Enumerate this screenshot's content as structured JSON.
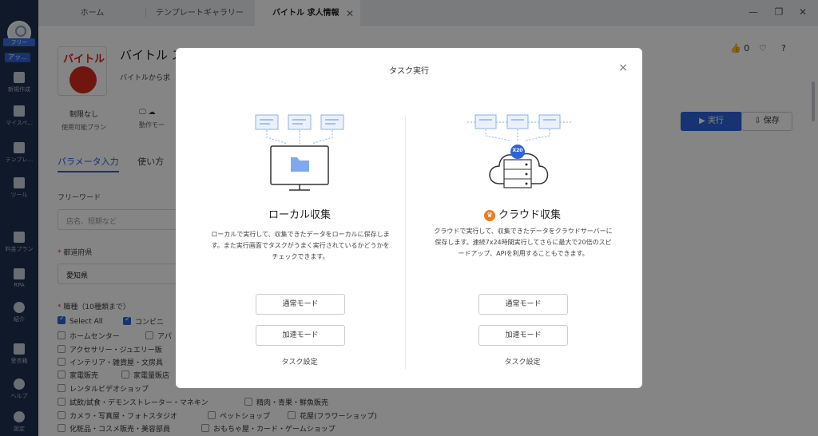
{
  "sidebar": {
    "badge_free": "フリー",
    "badge_upgrade": "アッ...",
    "items": [
      {
        "label": "新規作成",
        "icon": "plus-icon"
      },
      {
        "label": "マイスペ...",
        "icon": "bookmark-icon"
      },
      {
        "label": "テンプレ...",
        "icon": "template-icon"
      },
      {
        "label": "ツール",
        "icon": "toolbox-icon"
      },
      {
        "label": "料金プラン",
        "icon": "crown-icon"
      },
      {
        "label": "RPA",
        "icon": "rpa-icon"
      },
      {
        "label": "紹介",
        "icon": "dollar-icon"
      },
      {
        "label": "受信箱",
        "icon": "bell-icon"
      },
      {
        "label": "ヘルプ",
        "icon": "help-icon"
      },
      {
        "label": "設定",
        "icon": "gear-icon"
      }
    ]
  },
  "tabs": [
    {
      "label": "ホーム"
    },
    {
      "label": "テンプレートギャラリー"
    },
    {
      "label": "バイトル 求人情報",
      "close": "✕"
    }
  ],
  "window_controls": {
    "minimize": "—",
    "restore": "❐",
    "close": "✕"
  },
  "page": {
    "logo_text": "バイトル",
    "title": "バイトル ス",
    "subtitle": "バイトルから求",
    "meta": [
      {
        "value": "制限なし",
        "label": "使用可能プラン"
      },
      {
        "value": "🖵 ☁",
        "label": "動作モー"
      }
    ],
    "likes": "0",
    "run_label": "実行",
    "save_label": "保存",
    "param_tabs": [
      "パラメータ入力",
      "使い方"
    ],
    "freeword_label": "フリーワード",
    "freeword_placeholder": "店名、短期など",
    "pref_label": "都道府県",
    "pref_value": "愛知県",
    "job_label": "職種（10種類まで）",
    "checkboxes": [
      {
        "label": "Select All",
        "checked": true
      },
      {
        "label": "コンビニ",
        "checked": true
      },
      {
        "label": "ホームセンター",
        "checked": false
      },
      {
        "label": "アパ",
        "checked": false
      },
      {
        "label": "アクセサリー・ジュエリー販",
        "checked": false
      },
      {
        "label": "インテリア・雑貨屋・文房具",
        "checked": false
      },
      {
        "label": "家電販売",
        "checked": false
      },
      {
        "label": "家電量販店",
        "checked": false
      },
      {
        "label": "レンタルビデオショップ",
        "checked": false
      },
      {
        "label": "試飲/試食・デモンストレーター・マネキン",
        "checked": false
      },
      {
        "label": "精肉・青果・鮮魚販売",
        "checked": false
      },
      {
        "label": "カメラ・写真屋・フォトスタジオ",
        "checked": false
      },
      {
        "label": "ペットショップ",
        "checked": false
      },
      {
        "label": "花屋(フラワーショップ)",
        "checked": false
      },
      {
        "label": "化粧品・コスメ販売・美容部員",
        "checked": false
      },
      {
        "label": "おもちゃ屋・カード・ゲームショップ",
        "checked": false
      }
    ]
  },
  "modal": {
    "title": "タスク実行",
    "close": "×",
    "local": {
      "title": "ローカル収集",
      "desc": "ローカルで実行して、収集できたデータをローカルに保存します。また実行画面でタスクがうまく実行されているかどうかをチェックできます。",
      "normal_mode": "通常モード",
      "fast_mode": "加速モード",
      "task_settings": "タスク設定"
    },
    "cloud": {
      "title": "クラウド収集",
      "badge": "X20",
      "desc": "クラウドで実行して、収集できたデータをクラウドサーバーに保存します。連続7x24時間実行してさらに最大で20倍のスピードアップ、APIを利用することもできます。",
      "normal_mode": "通常モード",
      "fast_mode": "加速モード",
      "task_settings": "タスク設定"
    }
  },
  "colors": {
    "accent": "#2c63d8",
    "sidebar": "#1f3152",
    "cloud_orange": "#f07b1d"
  }
}
